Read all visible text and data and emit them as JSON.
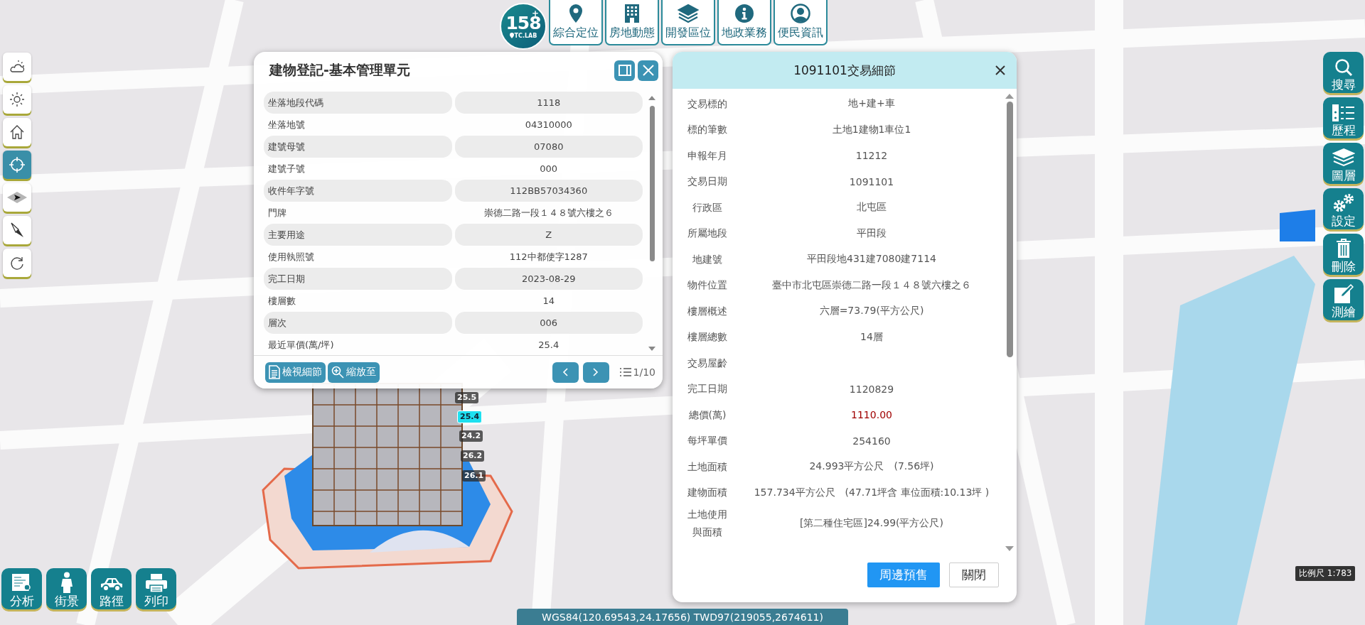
{
  "top_nav": {
    "logo": {
      "number": "158",
      "plus": "+",
      "subtitle": "TC.LAB"
    },
    "items": [
      {
        "label": "綜合定位"
      },
      {
        "label": "房地動態"
      },
      {
        "label": "開發區位"
      },
      {
        "label": "地政業務"
      },
      {
        "label": "便民資訊"
      }
    ]
  },
  "left_tools": [
    {
      "selected": false
    },
    {
      "selected": false
    },
    {
      "selected": false
    },
    {
      "selected": true
    },
    {
      "selected": false
    },
    {
      "selected": false
    },
    {
      "selected": false
    }
  ],
  "building_panel": {
    "title": "建物登記-基本管理單元",
    "rows": [
      {
        "label": "坐落地段代碼",
        "value": "1118"
      },
      {
        "label": "坐落地號",
        "value": "04310000"
      },
      {
        "label": "建號母號",
        "value": "07080"
      },
      {
        "label": "建號子號",
        "value": "000"
      },
      {
        "label": "收件年字號",
        "value": "112BB57034360"
      },
      {
        "label": "門牌",
        "value": "崇德二路一段１４８號六樓之６"
      },
      {
        "label": "主要用途",
        "value": "Z"
      },
      {
        "label": "使用執照號",
        "value": "112中都使字1287"
      },
      {
        "label": "完工日期",
        "value": "2023-08-29"
      },
      {
        "label": "樓層數",
        "value": "14"
      },
      {
        "label": "層次",
        "value": "006"
      },
      {
        "label": "最近單價(萬/坪)",
        "value": "25.4"
      }
    ],
    "actions": [
      {
        "label": "檢視細節"
      },
      {
        "label": "縮放至"
      }
    ],
    "pager": "1/10"
  },
  "map_labels": [
    {
      "text": "25.5",
      "selected": false
    },
    {
      "text": "25.4",
      "selected": true
    },
    {
      "text": "24.2",
      "selected": false
    },
    {
      "text": "26.2",
      "selected": false
    },
    {
      "text": "26.1",
      "selected": false
    }
  ],
  "deal_dialog": {
    "title": "1091101交易細節",
    "rows": [
      {
        "label": "交易標的",
        "value": "地+建+車",
        "highlight": false
      },
      {
        "label": "標的筆數",
        "value": "土地1建物1車位1",
        "highlight": false
      },
      {
        "label": "申報年月",
        "value": "11212",
        "highlight": false
      },
      {
        "label": "交易日期",
        "value": "1091101",
        "highlight": false
      },
      {
        "label": "行政區",
        "value": "北屯區",
        "highlight": false
      },
      {
        "label": "所屬地段",
        "value": "平田段",
        "highlight": false
      },
      {
        "label": "地建號",
        "value": "平田段地431建7080建7114",
        "highlight": false
      },
      {
        "label": "物件位置",
        "value": "臺中市北屯區崇德二路一段１４８號六樓之６",
        "highlight": false
      },
      {
        "label": "樓層概述",
        "value": "六層=73.79(平方公尺)",
        "highlight": false
      },
      {
        "label": "樓層總數",
        "value": "14層",
        "highlight": false
      },
      {
        "label": "交易屋齡"
      },
      {
        "label": "完工日期",
        "value": "1120829",
        "highlight": false
      },
      {
        "label": "總價(萬)",
        "value": "1110.00",
        "highlight": true
      },
      {
        "label": "每坪單價",
        "value": "254160",
        "highlight": false
      },
      {
        "label": "土地面積",
        "value": "24.993平方公尺　(7.56坪)",
        "highlight": false
      },
      {
        "label": "建物面積",
        "value": "157.734平方公尺　(47.71坪含 車位面積:10.13坪 )",
        "highlight": false
      },
      {
        "label": "土地使用與面積",
        "value": "[第二種住宅區]24.99(平方公尺)",
        "highlight": false
      }
    ],
    "buttons": [
      {
        "label": "周邊預售",
        "kind": "primary"
      },
      {
        "label": "關閉",
        "kind": "secondary"
      }
    ]
  },
  "right_tools": [
    {
      "label": "搜尋"
    },
    {
      "label": "歷程"
    },
    {
      "label": "圖層"
    },
    {
      "label": "設定"
    },
    {
      "label": "刪除"
    },
    {
      "label": "測繪"
    }
  ],
  "bottom_tools": [
    {
      "label": "分析"
    },
    {
      "label": "街景"
    },
    {
      "label": "路徑"
    },
    {
      "label": "列印"
    }
  ],
  "scale": "比例尺 1:783",
  "status_bar": "WGS84(120.69543,24.17656) TWD97(219055,2674611)"
}
